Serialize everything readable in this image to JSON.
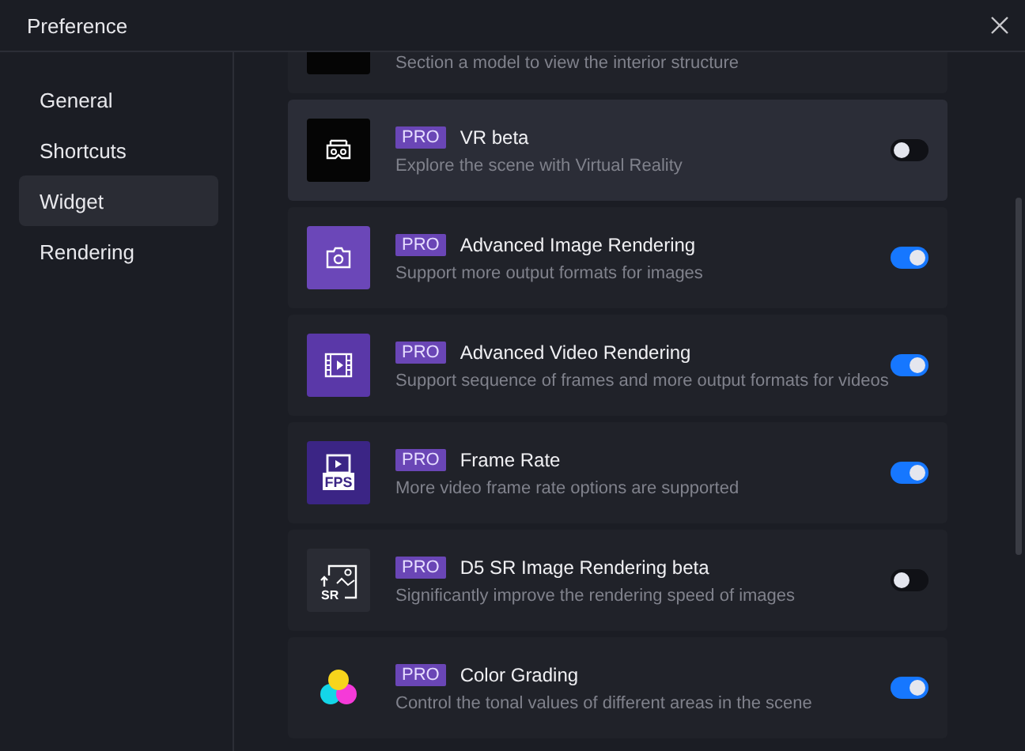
{
  "window": {
    "title": "Preference"
  },
  "sidebar": {
    "items": [
      {
        "label": "General",
        "selected": false
      },
      {
        "label": "Shortcuts",
        "selected": false
      },
      {
        "label": "Widget",
        "selected": true
      },
      {
        "label": "Rendering",
        "selected": false
      }
    ]
  },
  "partial_widget": {
    "description": "Section a model to view the interior structure"
  },
  "widgets": [
    {
      "kind": "vr",
      "pro": "PRO",
      "title": "VR beta",
      "description": "Explore the scene with Virtual Reality",
      "on": false,
      "highlighted": true
    },
    {
      "kind": "camera",
      "pro": "PRO",
      "title": "Advanced Image Rendering",
      "description": "Support more output formats for images",
      "on": true,
      "highlighted": false
    },
    {
      "kind": "film",
      "pro": "PRO",
      "title": "Advanced Video Rendering",
      "description": "Support sequence of frames and more output formats for videos",
      "on": true,
      "highlighted": false
    },
    {
      "kind": "fps",
      "icon_text": "FPS",
      "pro": "PRO",
      "title": "Frame Rate",
      "description": "More video frame rate options are supported",
      "on": true,
      "highlighted": false
    },
    {
      "kind": "sr",
      "icon_text": "SR",
      "pro": "PRO",
      "title": "D5 SR Image Rendering beta",
      "description": "Significantly improve the rendering speed of images",
      "on": false,
      "highlighted": false
    },
    {
      "kind": "color",
      "pro": "PRO",
      "title": "Color Grading",
      "description": "Control the tonal values of different areas in the scene",
      "on": true,
      "highlighted": false
    }
  ]
}
